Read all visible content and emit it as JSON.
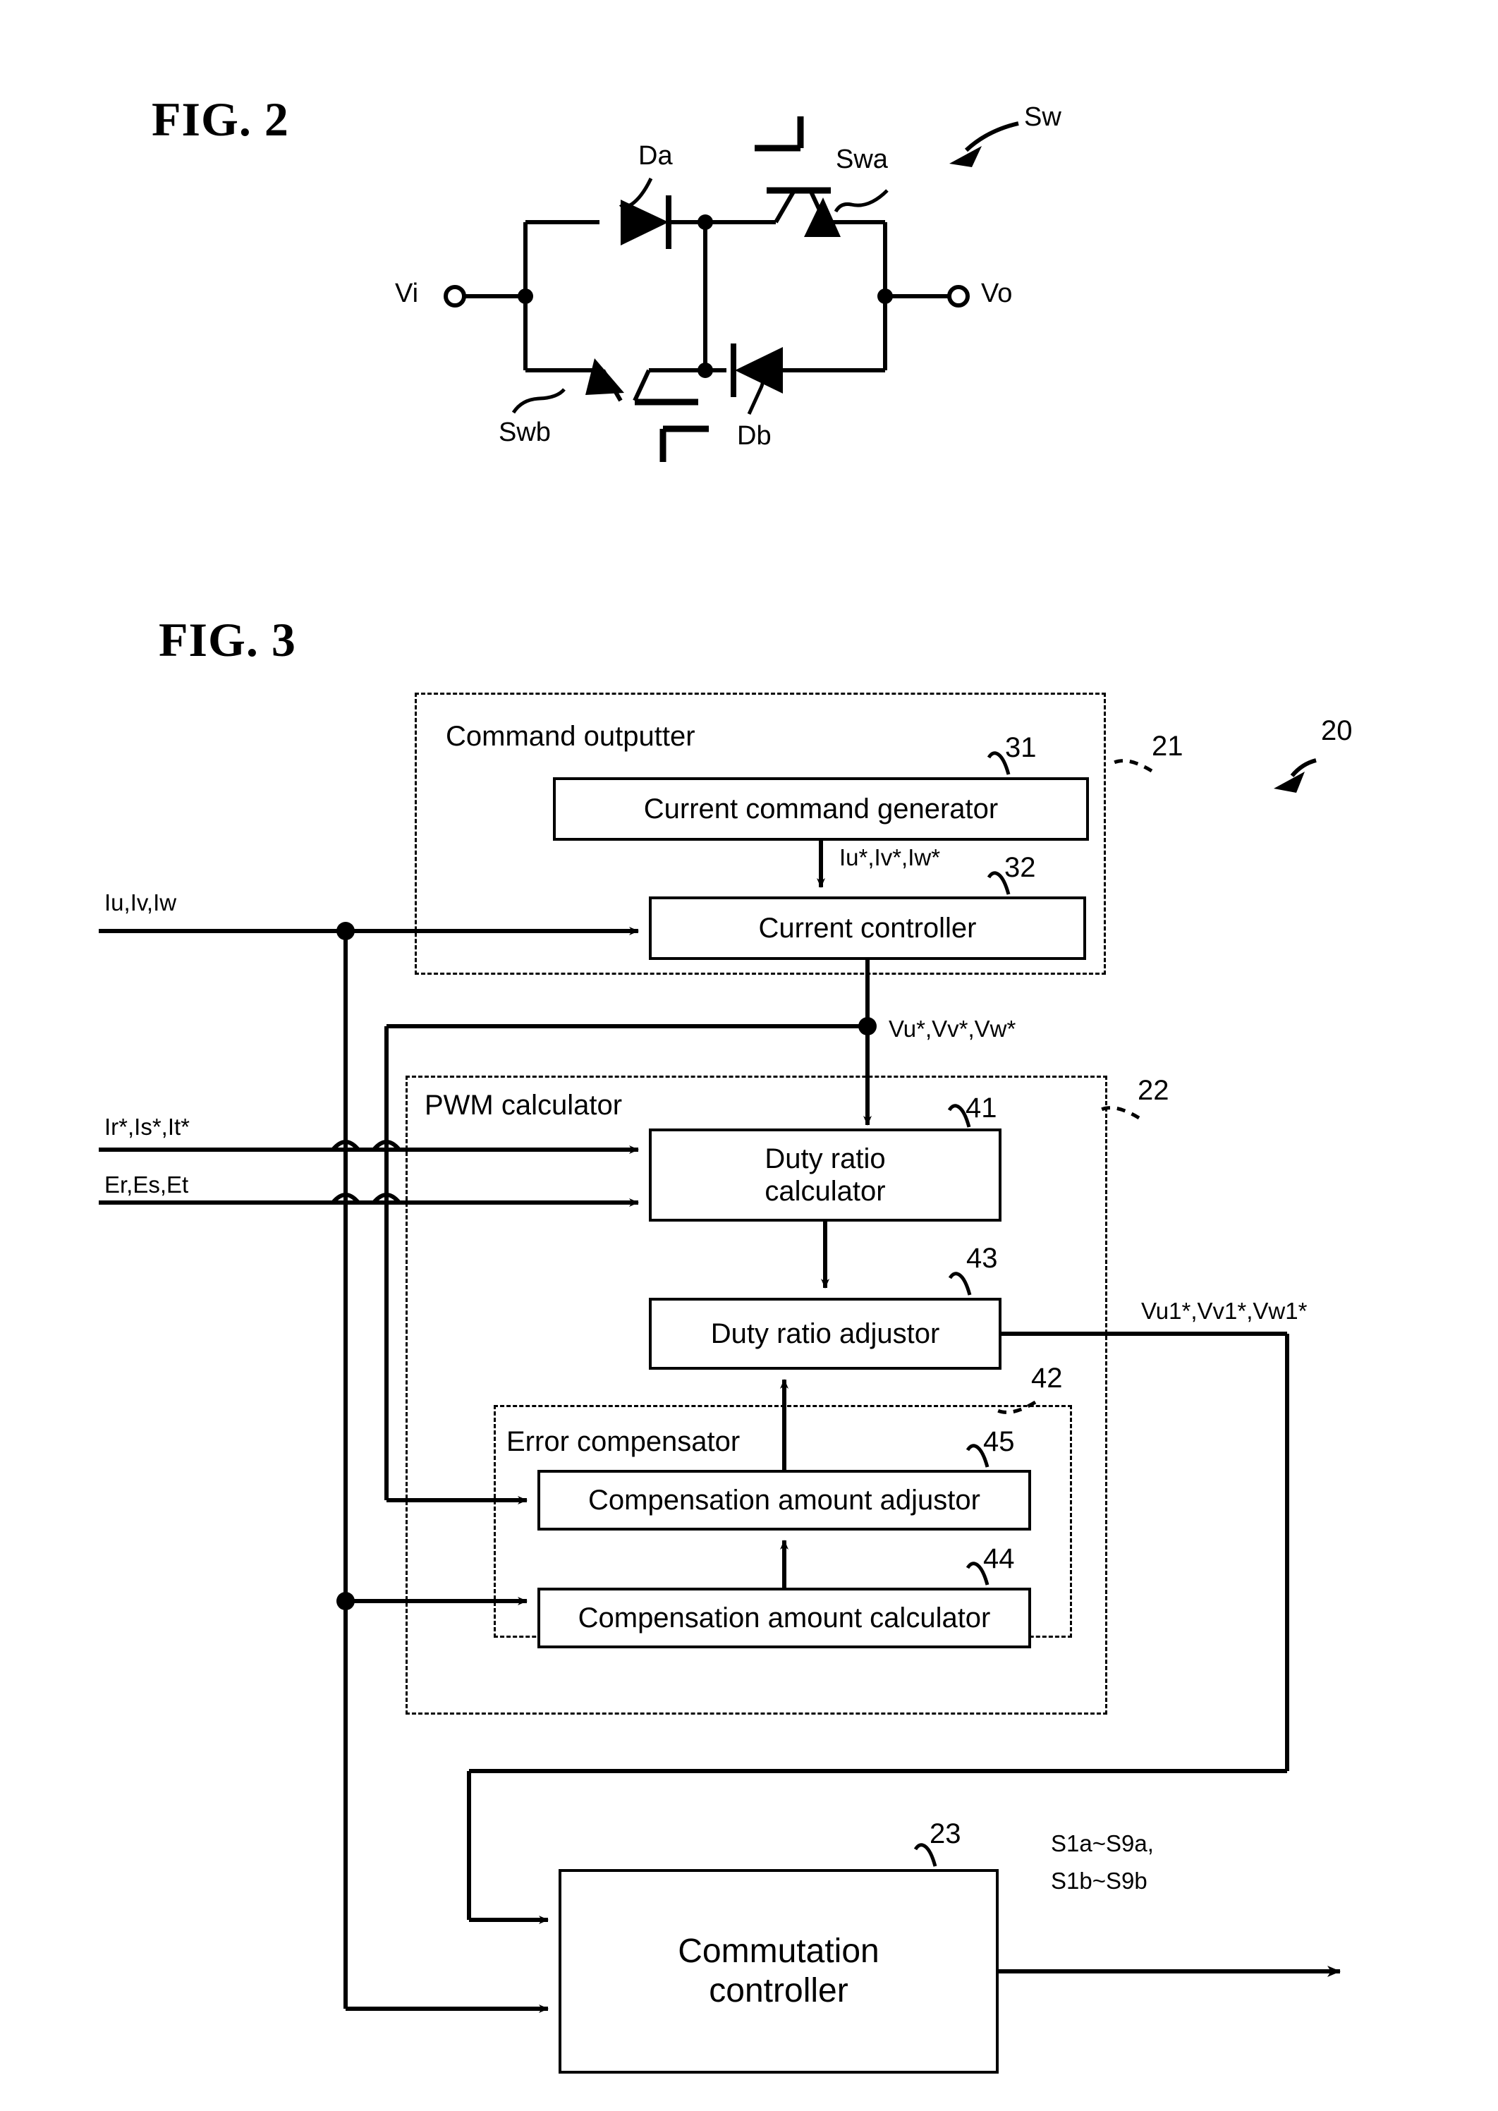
{
  "figures": {
    "fig2": {
      "title": "FIG. 2",
      "callout": "Sw",
      "terminals": {
        "input": "Vi",
        "output": "Vo"
      },
      "components": [
        {
          "id": "Da",
          "label": "Da",
          "type": "diode"
        },
        {
          "id": "Swa",
          "label": "Swa",
          "type": "igbt"
        },
        {
          "id": "Swb",
          "label": "Swb",
          "type": "igbt"
        },
        {
          "id": "Db",
          "label": "Db",
          "type": "diode"
        }
      ]
    },
    "fig3": {
      "title": "FIG. 3",
      "callout": "20",
      "groups": [
        {
          "ref": "21",
          "label": "Command outputter"
        },
        {
          "ref": "22",
          "label": "PWM calculator"
        },
        {
          "ref": "42",
          "label": "Error compensator"
        }
      ],
      "blocks": [
        {
          "ref": "31",
          "label": "Current command generator"
        },
        {
          "ref": "32",
          "label": "Current controller"
        },
        {
          "ref": "41",
          "label": "Duty ratio\ncalculator"
        },
        {
          "ref": "43",
          "label": "Duty ratio adjustor"
        },
        {
          "ref": "45",
          "label": "Compensation amount adjustor"
        },
        {
          "ref": "44",
          "label": "Compensation amount calculator"
        },
        {
          "ref": "23",
          "label": "Commutation\ncontroller"
        }
      ],
      "signals": {
        "current_feedback": "Iu,Iv,Iw",
        "current_command": "Iu*,Iv*,Iw*",
        "voltage_command": "Vu*,Vv*,Vw*",
        "source_current_command": "Ir*,Is*,It*",
        "source_voltage": "Er,Es,Et",
        "adjusted_voltage_command": "Vu1*,Vv1*,Vw1*",
        "gate_signals_line1": "S1a~S9a,",
        "gate_signals_line2": "S1b~S9b"
      }
    }
  },
  "colors": {
    "ink": "#000000",
    "paper": "#ffffff"
  }
}
